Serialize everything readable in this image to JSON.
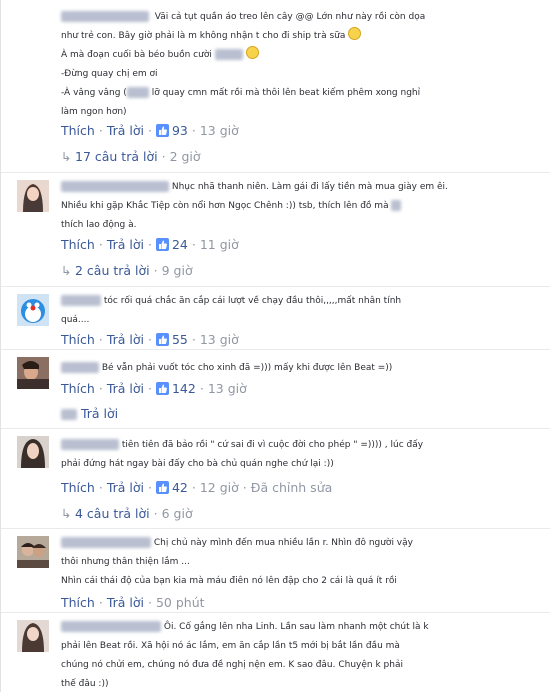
{
  "comments": [
    {
      "lines": [
        "Vãi cả tụt quần áo treo lên cây @@ Lớn như này rồi còn dọa",
        "như trẻ con. Bây giờ phải là m không nhận t cho đi ship trà sữa",
        "À mà đoạn cuối bà béo buồn cười",
        "-Đừng quay chị em ơi",
        "-À vâng vâng (",
        "lỡ quay cmn mất rồi mà thôi lên beat kiếm phêm xong nghỉ",
        "làm ngon hơn)"
      ],
      "like": "Thích",
      "reply": "Trả lời",
      "likes": "93",
      "time": "13 giờ",
      "replies": "17 câu trả lời",
      "replies_time": "2 giờ"
    },
    {
      "lines": [
        "Nhục nhã thanh niên. Làm gái đi lấy tiền mà mua giày em êi.",
        "Nhiều khi gặp Khắc Tiệp còn nổi hơn Ngọc Chênh :)) tsb, thích lên đồ mà",
        "thích lao động à."
      ],
      "like": "Thích",
      "reply": "Trả lời",
      "likes": "24",
      "time": "11 giờ",
      "replies": "2 câu trả lời",
      "replies_time": "9 giờ"
    },
    {
      "lines": [
        "tóc rối quá chắc ăn cắp cái lượt về chạy đầu thôi,,,,,mất nhân tính",
        "quá...."
      ],
      "like": "Thích",
      "reply": "Trả lời",
      "likes": "55",
      "time": "13 giờ"
    },
    {
      "lines": [
        "Bé vẫn phải vuốt tóc cho xinh đã =))) mấy khi được lên Beat =))"
      ],
      "like": "Thích",
      "reply": "Trả lời",
      "likes": "142",
      "time": "13 giờ",
      "replies": "Trả lời"
    },
    {
      "lines": [
        "tiên tiên đã bảo rồi \" cứ sai đi vì cuộc đời cho phép \" =)))) , lúc đấy",
        "phải đứng hát ngay bài đấy cho bà chủ quán nghe chứ lại :))"
      ],
      "like": "Thích",
      "reply": "Trả lời",
      "likes": "42",
      "time": "12 giờ",
      "edited": "Đã chỉnh sửa",
      "replies": "4 câu trả lời",
      "replies_time": "6 giờ"
    },
    {
      "lines": [
        "Chị chủ này mình đến mua nhiều lần r. Nhìn đô người vậy",
        "thôi nhưng thân thiện lắm ...",
        "Nhìn cái thái độ của bạn kia mà máu điên nó lên đập cho 2 cái là quá ít rồi"
      ],
      "like": "Thích",
      "reply": "Trả lời",
      "time": "50 phút"
    },
    {
      "lines": [
        "Ôi. Cố gắng lên nha Linh. Lần sau làm nhanh một chút là k",
        "phải lên Beat rồi. Xã hội nó ác lắm, em ăn cắp lần t5 mới bị bắt lần đầu mà",
        "chúng nó chửi em, chúng nó đưa đề nghị nện em. K sao đâu. Chuyện k phải",
        "thế đâu :))"
      ]
    }
  ],
  "colors": {
    "link": "#3b5998",
    "muted": "#9197a3",
    "like_badge": "#5890ff"
  }
}
